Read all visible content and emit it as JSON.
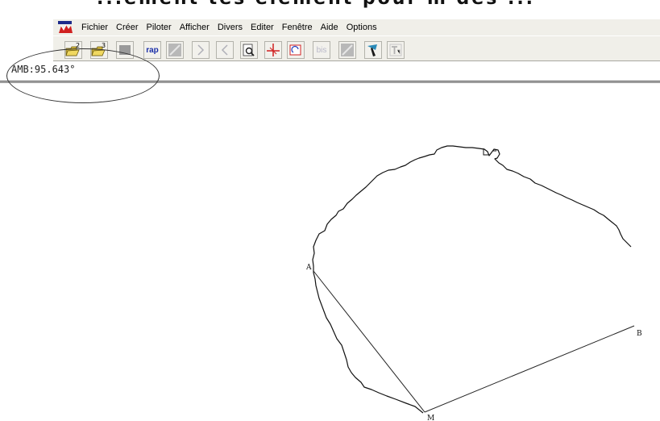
{
  "page_header_fragment": "...ement tes élément pour m des ...",
  "menu": {
    "items": [
      {
        "id": "fichier",
        "label": "Fichier"
      },
      {
        "id": "creer",
        "label": "Créer"
      },
      {
        "id": "piloter",
        "label": "Piloter"
      },
      {
        "id": "afficher",
        "label": "Afficher"
      },
      {
        "id": "divers",
        "label": "Divers"
      },
      {
        "id": "editer",
        "label": "Editer"
      },
      {
        "id": "fenetre",
        "label": "Fenêtre"
      },
      {
        "id": "aide",
        "label": "Aide"
      },
      {
        "id": "options",
        "label": "Options"
      }
    ]
  },
  "toolbar": {
    "open_2_badge": "2",
    "open_3_badge": "3",
    "rap_label": "rap",
    "bis_label": "bis"
  },
  "status": {
    "angle_readout": "AMB:95.643°"
  },
  "figure": {
    "point_a": "A",
    "point_b": "B",
    "point_m": "M"
  }
}
